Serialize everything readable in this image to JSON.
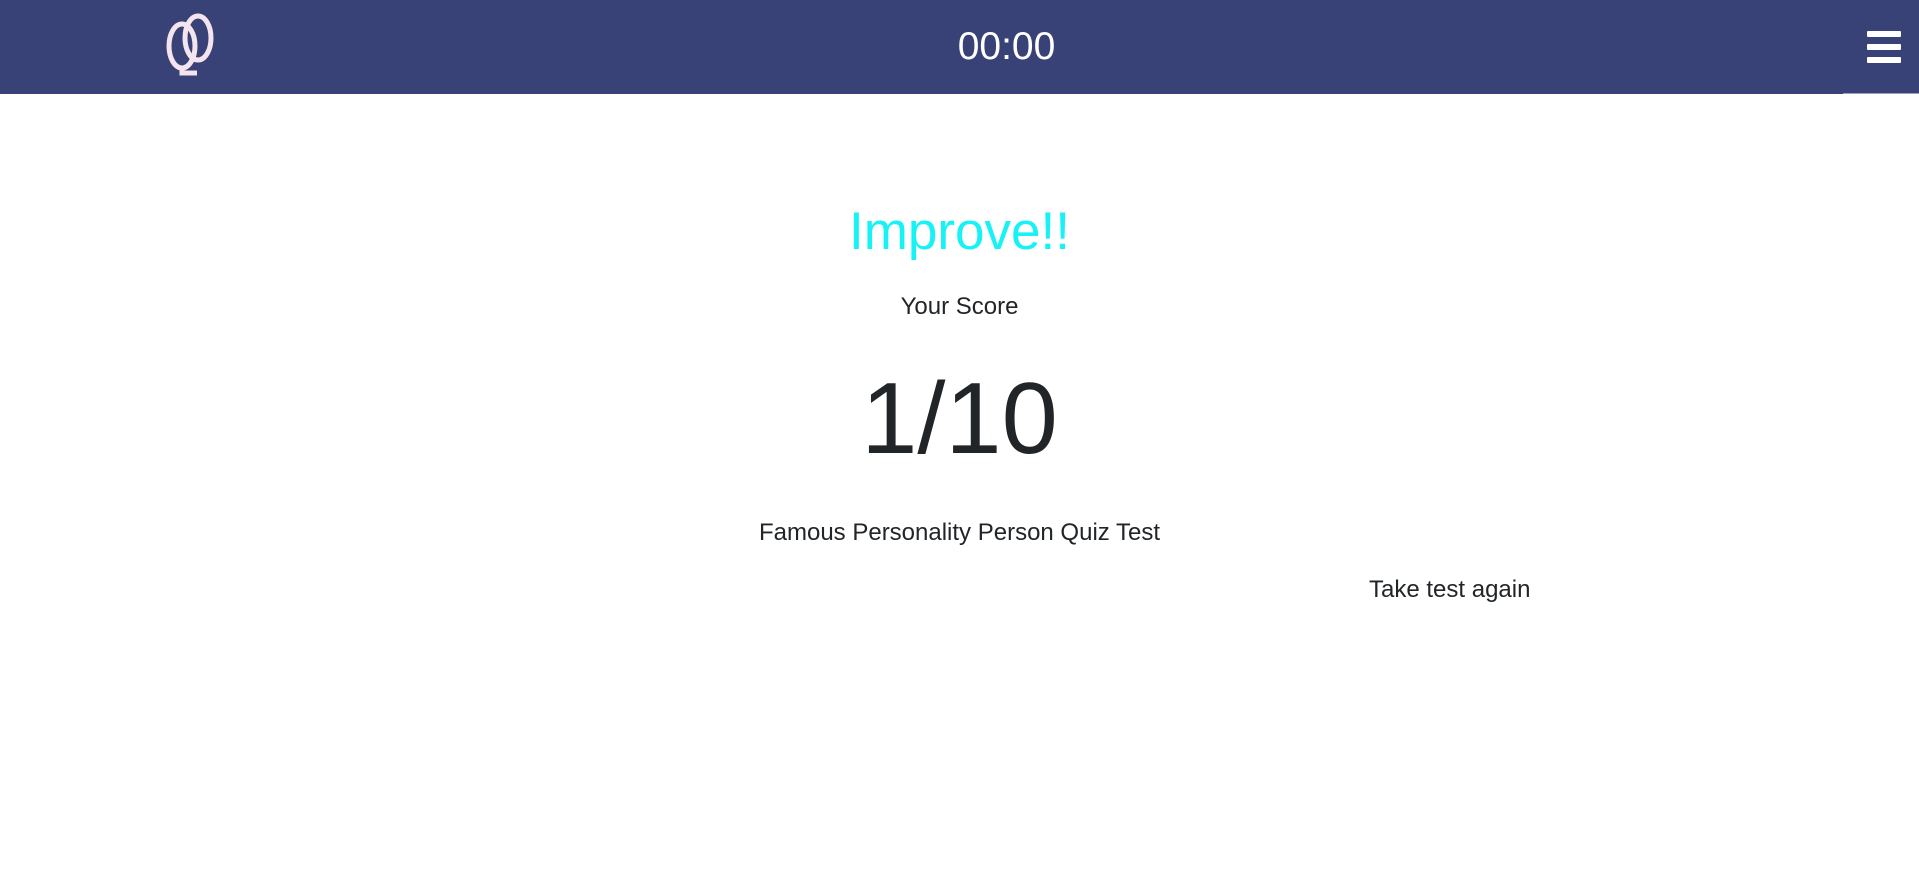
{
  "header": {
    "logo_icon": "quiz-q-logo-icon",
    "timer": "00:00",
    "menu_icon": "hamburger-menu-icon",
    "background_color": "#384277"
  },
  "result": {
    "headline": "Improve!!",
    "headline_color": "#17f2f7",
    "score_label": "Your Score",
    "score": "1/10",
    "quiz_name": "Famous Personality Person Quiz Test",
    "retake_link": "Take test again"
  }
}
